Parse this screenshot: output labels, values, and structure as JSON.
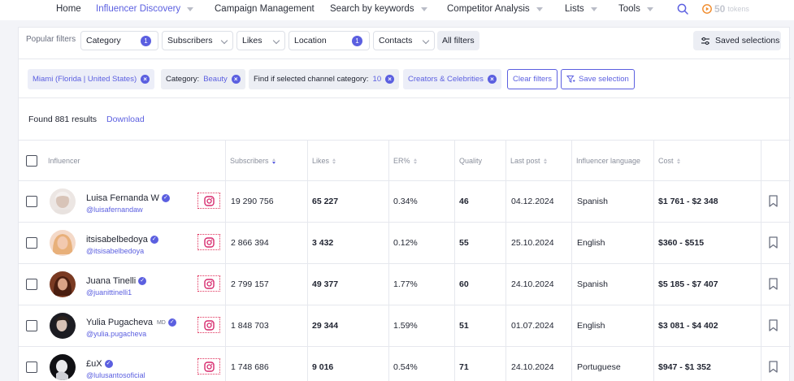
{
  "nav": {
    "items": [
      {
        "label": "Home",
        "active": false,
        "dropdown": false
      },
      {
        "label": "Influencer Discovery",
        "active": true,
        "dropdown": true
      },
      {
        "label": "Campaign Management",
        "active": false,
        "dropdown": false
      },
      {
        "label": "Search by keywords",
        "active": false,
        "dropdown": true
      },
      {
        "label": "Competitor Analysis",
        "active": false,
        "dropdown": true
      },
      {
        "label": "Lists",
        "active": false,
        "dropdown": true
      },
      {
        "label": "Tools",
        "active": false,
        "dropdown": true
      }
    ],
    "tokens_count": "50",
    "tokens_label": "tokens"
  },
  "filters": {
    "popular_label": "Popular filters",
    "category": {
      "label": "Category",
      "count": "1"
    },
    "subscribers": {
      "label": "Subscribers"
    },
    "likes": {
      "label": "Likes"
    },
    "location": {
      "label": "Location",
      "count": "1"
    },
    "contacts": {
      "label": "Contacts"
    },
    "all_filters": "All filters",
    "saved_selections": "Saved selections"
  },
  "chips": {
    "location": "Miami (Florida | United States)",
    "category_label": "Category:",
    "category_value": "Beauty",
    "find_label": "Find if selected channel category:",
    "find_value": "10",
    "creators": "Creators & Celebrities",
    "clear_filters": "Clear filters",
    "save_selection": "Save selection"
  },
  "results": {
    "found": "Found 881 results",
    "download": "Download"
  },
  "table": {
    "headers": {
      "influencer": "Influencer",
      "subscribers": "Subscribers",
      "likes": "Likes",
      "er": "ER%",
      "quality": "Quality",
      "last_post": "Last post",
      "language": "Influencer language",
      "cost": "Cost"
    },
    "rows": [
      {
        "name": "Luisa Fernanda W",
        "handle": "@luisafernandaw",
        "subscribers": "19 290 756",
        "likes": "65 227",
        "er": "0.34%",
        "quality": "46",
        "last_post": "04.12.2024",
        "language": "Spanish",
        "cost": "$1 761 - $2 348"
      },
      {
        "name": "itsisabelbedoya",
        "handle": "@itsisabelbedoya",
        "subscribers": "2 866 394",
        "likes": "3 432",
        "er": "0.12%",
        "quality": "55",
        "last_post": "25.10.2024",
        "language": "English",
        "cost": "$360 - $515"
      },
      {
        "name": "Juana Tinelli",
        "handle": "@juanittinelli1",
        "subscribers": "2 799 157",
        "likes": "49 377",
        "er": "1.77%",
        "quality": "60",
        "last_post": "24.10.2024",
        "language": "Spanish",
        "cost": "$5 185 - $7 407"
      },
      {
        "name": "Yulia Pugacheva",
        "badge": "MD",
        "handle": "@yulia.pugacheva",
        "subscribers": "1 848 703",
        "likes": "29 344",
        "er": "1.59%",
        "quality": "51",
        "last_post": "01.07.2024",
        "language": "English",
        "cost": "$3 081 - $4 402"
      },
      {
        "name": "£uX",
        "handle": "@lulusantosoficial",
        "subscribers": "1 748 686",
        "likes": "9 016",
        "er": "0.54%",
        "quality": "71",
        "last_post": "24.10.2024",
        "language": "Portuguese",
        "cost": "$947 - $1 352"
      }
    ]
  }
}
